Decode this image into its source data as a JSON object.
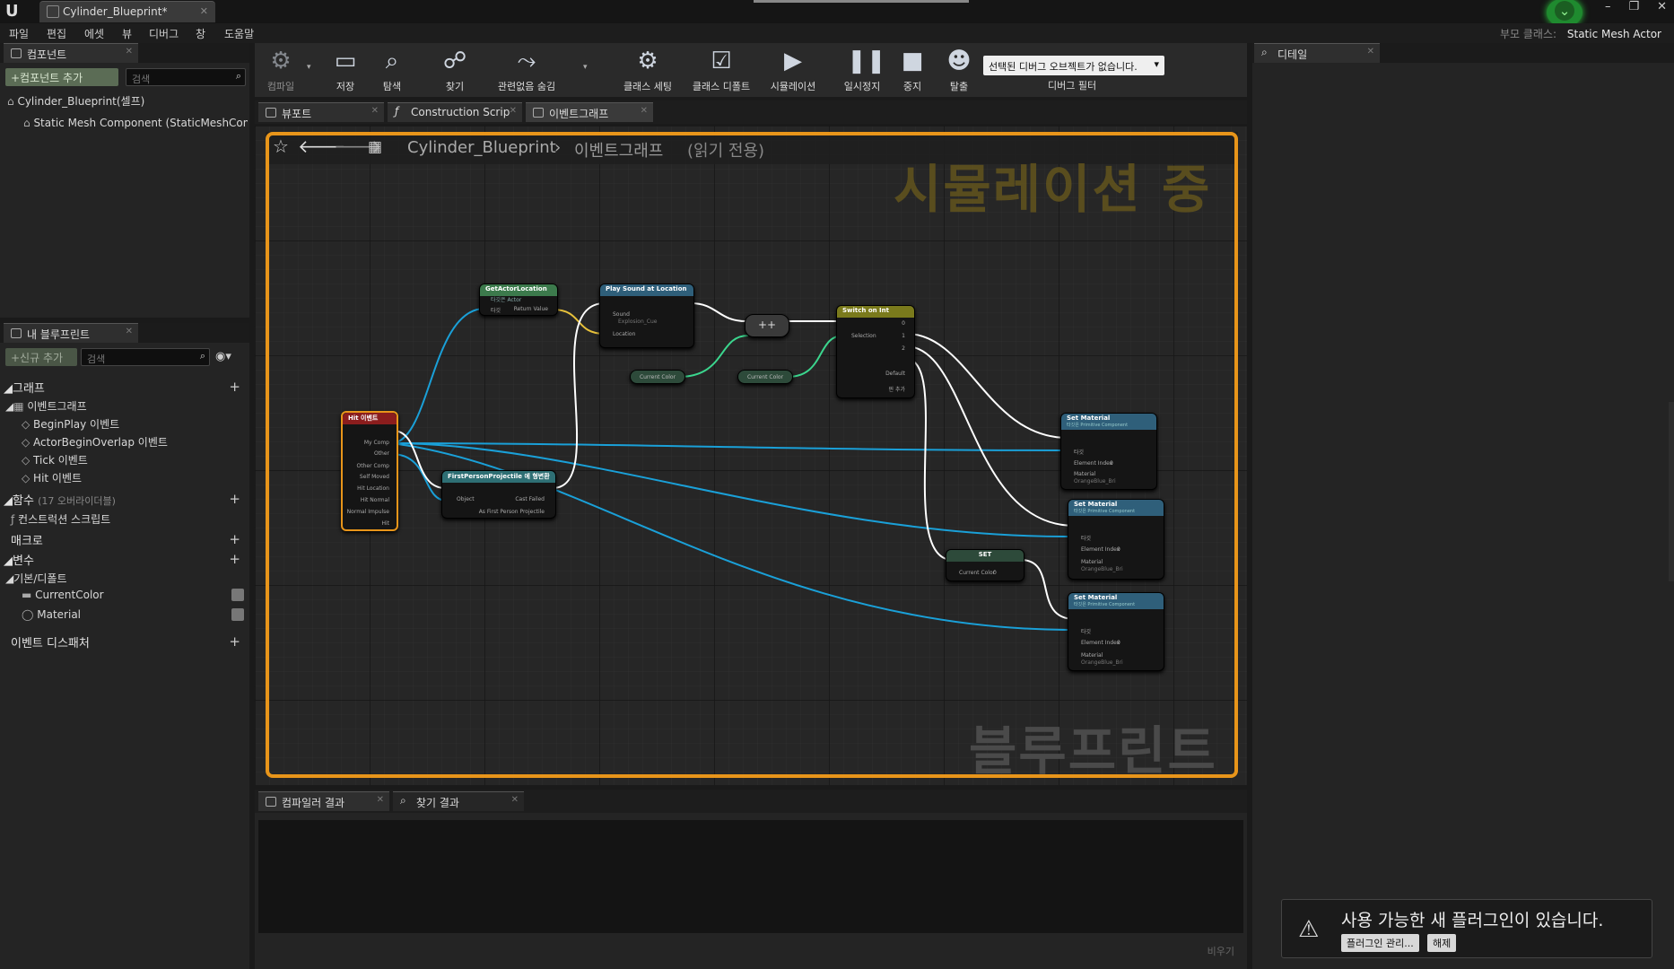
{
  "window": {
    "tab_title": "Cylinder_Blueprint*",
    "parent_class_label": "부모 클래스:",
    "parent_class_value": "Static Mesh Actor"
  },
  "menu": [
    "파일",
    "편집",
    "에셋",
    "뷰",
    "디버그",
    "창",
    "도움말"
  ],
  "components_panel": {
    "tab": "컴포넌트",
    "add_button": "+컴포넌트 추가",
    "search_placeholder": "검색",
    "root": "Cylinder_Blueprint(셀프)",
    "child": "Static Mesh Component (StaticMeshCompo"
  },
  "my_blueprint": {
    "tab": "내 블루프린트",
    "add_button": "+신규 추가",
    "search_placeholder": "검색",
    "graphs_label": "그래프",
    "event_graph": "이벤트그래프",
    "events": [
      "BeginPlay 이벤트",
      "ActorBeginOverlap 이벤트",
      "Tick 이벤트",
      "Hit 이벤트"
    ],
    "functions_label": "함수",
    "functions_note": "(17 오버라이더블)",
    "construction_script": "컨스트럭션 스크립트",
    "macros_label": "매크로",
    "variables_label": "변수",
    "defaults_label": "기본/디폴트",
    "variables": [
      "CurrentColor",
      "Material"
    ],
    "dispatchers_label": "이벤트 디스패처"
  },
  "toolbar": {
    "buttons": [
      "컴파일",
      "저장",
      "탐색",
      "찾기",
      "관련없음 숨김",
      "클래스 세팅",
      "클래스 디폴트",
      "시뮬레이션",
      "일시정지",
      "중지",
      "탈출"
    ],
    "debug_select": "선택된 디버그 오브젝트가 없습니다.",
    "debug_filter": "디버그 필터"
  },
  "graph_tabs": [
    "뷰포트",
    "Construction Scrip",
    "이벤트그래프"
  ],
  "breadcrumb": {
    "blueprint": "Cylinder_Blueprint",
    "graph": "이벤트그래프",
    "mode": "(읽기 전용)"
  },
  "watermarks": {
    "simulating": "시뮬레이션 중",
    "blueprint": "블루프린트"
  },
  "nodes": {
    "hit": {
      "title": "Hit 이벤트",
      "pins": [
        "My Comp",
        "Other",
        "Other Comp",
        "Self Moved",
        "Hit Location",
        "Hit Normal",
        "Normal Impulse",
        "Hit"
      ]
    },
    "get_actor_location": {
      "title": "GetActorLocation",
      "sub": "타깃은 Actor",
      "pins": [
        "타깃",
        "Return Value"
      ]
    },
    "play_sound": {
      "title": "Play Sound at Location",
      "pins": [
        "Sound",
        "Explosion_Cue",
        "Location"
      ]
    },
    "cast": {
      "title": "FirstPersonProjectile 에 형변환",
      "pins": [
        "Object",
        "Cast Failed",
        "As First Person Projectile"
      ]
    },
    "increment": {
      "label": "++"
    },
    "current_color_1": {
      "label": "Current Color"
    },
    "current_color_2": {
      "label": "Current Color"
    },
    "switch": {
      "title": "Switch on Int",
      "pins": [
        "Selection",
        "0",
        "1",
        "2",
        "Default",
        "핀 추가"
      ]
    },
    "set_material_1": {
      "title": "Set Material",
      "sub": "타깃은 Primitive Component",
      "pins": [
        "타깃",
        "Element Index",
        "0",
        "Material",
        "OrangeBlue_Bri"
      ]
    },
    "set_material_2": {
      "title": "Set Material",
      "sub": "타깃은 Primitive Component",
      "pins": [
        "타깃",
        "Element Index",
        "0",
        "Material",
        "OrangeBlue_Bri"
      ]
    },
    "set_material_3": {
      "title": "Set Material",
      "sub": "타깃은 Primitive Component",
      "pins": [
        "타깃",
        "Element Index",
        "0",
        "Material",
        "OrangeBlue_Bri"
      ]
    },
    "set": {
      "title": "SET",
      "pins": [
        "Current Color",
        "0"
      ]
    }
  },
  "details_panel": {
    "tab": "디테일"
  },
  "bottom": {
    "tabs": [
      "컴파일러 결과",
      "찾기 결과"
    ],
    "clear": "비우기"
  },
  "toast": {
    "message": "사용 가능한 새 플러그인이 있습니다.",
    "manage": "플러그인 관리...",
    "dismiss": "해제"
  },
  "colors": {
    "accent": "#e8951a",
    "exec": "#ffffff",
    "object_wire": "#1aa0d8",
    "vector_wire": "#e8c23b",
    "int_wire": "#3bd68e"
  }
}
